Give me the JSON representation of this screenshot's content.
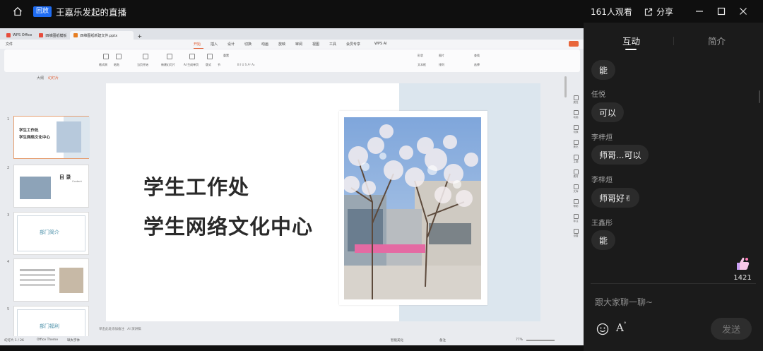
{
  "header": {
    "replay_badge": "回放",
    "title": "王嘉乐发起的直播",
    "viewers": "161人观看",
    "share_label": "分享"
  },
  "wps": {
    "tabs": [
      {
        "label": "WPS Office",
        "color": "#e74c3c"
      },
      {
        "label": "四维图纸模板",
        "color": "#e74c3c"
      },
      {
        "label": "四维图纸新建文件.pptx",
        "color": "#e67e22"
      }
    ],
    "menu": [
      "文件",
      "开始",
      "插入",
      "设计",
      "切换",
      "动画",
      "放映",
      "审阅",
      "视图",
      "工具",
      "会员专享",
      "WPS AI"
    ],
    "active_menu": "开始",
    "ribbon_labels": [
      "格式刷",
      "粘贴",
      "当页开始",
      "新建幻灯片",
      "AI 生成单页",
      "版式",
      "节",
      "重置",
      "形状",
      "图片",
      "文本框",
      "排列",
      "查找",
      "选择"
    ],
    "thumb_header": {
      "outline": "大纲",
      "slides": "幻灯片"
    },
    "thumbnails": [
      {
        "num": "1",
        "line1": "学生工作处",
        "line2": "学生网络文化中心"
      },
      {
        "num": "2",
        "line1": "目 录",
        "line2": "Content"
      },
      {
        "num": "3",
        "line1": "部门简介",
        "line2": ""
      },
      {
        "num": "4",
        "line1": "",
        "line2": ""
      },
      {
        "num": "5",
        "line1": "部门福利",
        "line2": ""
      }
    ],
    "slide": {
      "title_line1": "学生工作处",
      "title_line2": "学生网络文化中心"
    },
    "right_toolbar": [
      "属性",
      "动画",
      "切换",
      "美化",
      "主题",
      "素材",
      "文库",
      "帮助",
      "标注",
      "设置"
    ],
    "notes_placeholder": "单击此处添加备注",
    "ai_notes": "AI 演讲稿",
    "status": {
      "slide_count": "幻灯片 1 / 26",
      "theme": "Office Theme",
      "missing_font": "缺失字体",
      "smart_beautify": "智能美化",
      "notes": "备注",
      "zoom": "77%"
    }
  },
  "chat": {
    "tab_active": "互动",
    "tab_inactive": "简介",
    "messages": [
      {
        "name": "",
        "text": "能"
      },
      {
        "name": "任悦",
        "text": "可以"
      },
      {
        "name": "李梓烜",
        "text": "师哥...可以"
      },
      {
        "name": "李梓烜",
        "text": "师哥好✌"
      },
      {
        "name": "王鑫彤",
        "text": "能"
      }
    ],
    "likes": "1421",
    "input_placeholder": "跟大家聊一聊~",
    "send_label": "发送"
  }
}
